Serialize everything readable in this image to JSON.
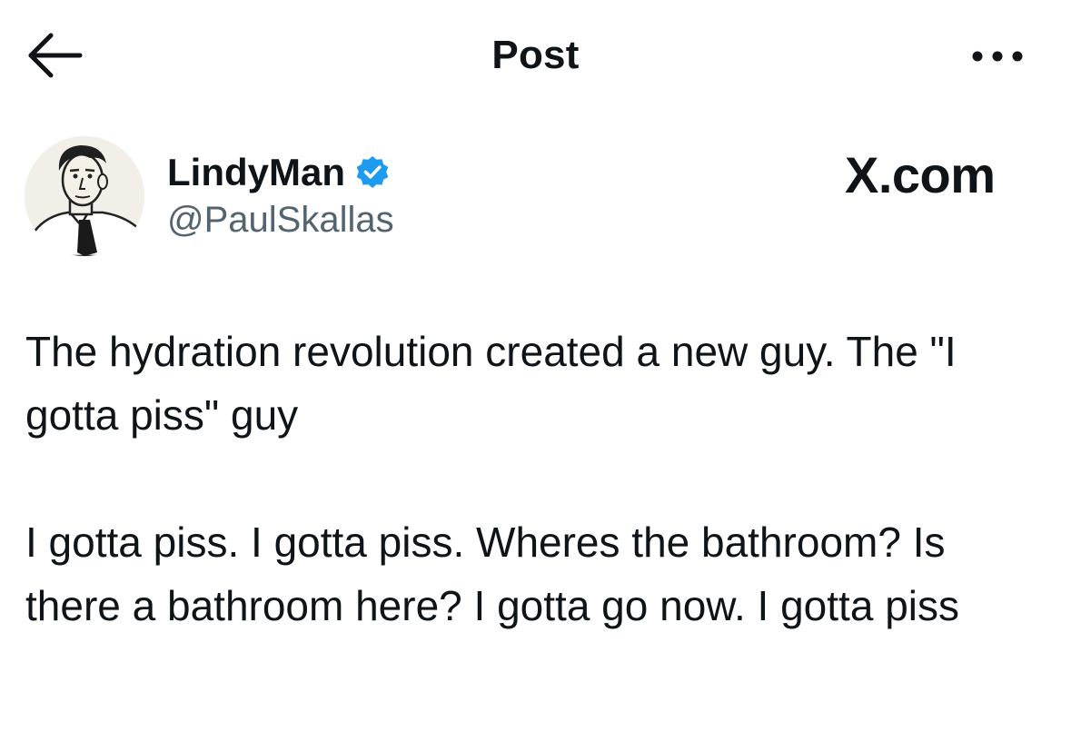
{
  "header": {
    "title": "Post",
    "back_icon": "arrow-left-icon",
    "more_icon": "more-horizontal-icon"
  },
  "author": {
    "display_name": "LindyMan",
    "handle": "@PaulSkallas",
    "verified": true,
    "verified_color": "#1d9bf0",
    "avatar": "cartoon-man-with-tie-avatar"
  },
  "watermark": "X.com",
  "post": {
    "paragraphs": [
      "The hydration revolution created a new guy. The \"I gotta piss\" guy",
      "I gotta piss. I gotta piss. Wheres the bathroom? Is there a bathroom here? I gotta go now. I gotta piss"
    ]
  },
  "colors": {
    "text_primary": "#0f1419",
    "text_secondary": "#536471",
    "background": "#ffffff"
  }
}
